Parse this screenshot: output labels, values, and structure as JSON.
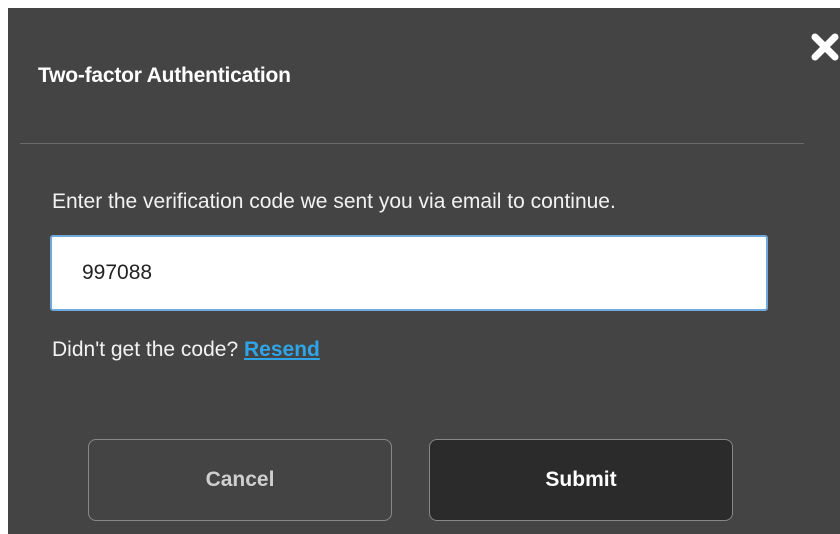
{
  "dialog": {
    "title": "Two-factor Authentication",
    "instructions": "Enter the verification code we sent you via email to continue.",
    "code_input": {
      "value": "997088",
      "placeholder": ""
    },
    "resend": {
      "prompt": "Didn't get the code?",
      "link_label": "Resend"
    },
    "buttons": {
      "cancel_label": "Cancel",
      "submit_label": "Submit"
    },
    "icons": {
      "close": "close-icon"
    }
  },
  "colors": {
    "dialog_bg": "#444444",
    "link": "#2fa4e7",
    "input_border": "#6fa8dc",
    "submit_bg": "#2b2b2b"
  }
}
